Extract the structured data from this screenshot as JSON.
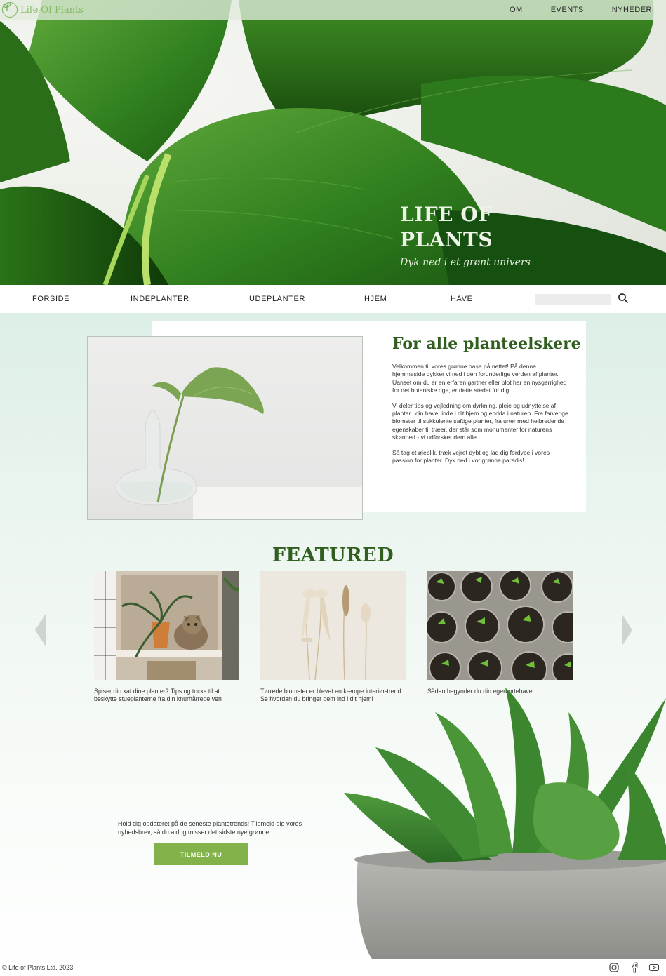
{
  "brand": {
    "name": "Life Of Plants"
  },
  "top_nav": {
    "items": [
      "OM",
      "EVENTS",
      "NYHEDER"
    ]
  },
  "hero": {
    "title": "LIFE OF\nPLANTS",
    "subtitle": "Dyk ned i et grønt univers"
  },
  "main_nav": {
    "items": [
      "FORSIDE",
      "INDEPLANTER",
      "UDEPLANTER",
      "HJEM",
      "HAVE"
    ],
    "search_placeholder": ""
  },
  "intro": {
    "heading": "For alle planteelskere",
    "paragraphs": [
      "Velkommen til vores grønne oase på nettet! På denne hjemmeside dykker vi ned i den forunderlige verden af planter. Uanset om du er en erfaren gartner eller blot har en nysgerrighed for det botaniske rige, er dette stedet for dig.",
      "Vi deler tips og vejledning om dyrkning, pleje og udnyttelse af planter i din have, inde i dit hjem og endda i naturen. Fra farverige blomster til sukkulente saftige planter, fra urter med helbredende egenskaber til træer, der står som monumenter for naturens skønhed - vi udforsker dem alle.",
      "Så tag et øjeblik, træk vejret dybt og lad dig fordybe i vores passion for planter. Dyk ned i vor grønne paradis!"
    ]
  },
  "featured": {
    "title": "FEATURED",
    "cards": [
      {
        "caption": "Spiser din kat dine planter? Tips og tricks til at beskytte stueplanterne fra din knurhårrede ven"
      },
      {
        "caption": "Tørrede blomster er blevet en kæmpe interiør-trend. Se hvordan du bringer dem ind i dit hjem!"
      },
      {
        "caption": "Sådan begynder du din egen urtehave"
      }
    ]
  },
  "newsletter": {
    "text": "Hold dig opdateret på de seneste plantetrends! Tildmeld dig vores nyhedsbrev, så du aldrig misser det sidste nye grønne:",
    "button": "TILMELD NU"
  },
  "footer": {
    "copyright": "© Life of Plants Ltd. 2023",
    "social_icons": [
      "instagram-icon",
      "facebook-icon",
      "youtube-icon"
    ]
  },
  "colors": {
    "accent_green": "#2f5e1f",
    "button_green": "#84b24a",
    "logo_green": "#84bb66"
  }
}
